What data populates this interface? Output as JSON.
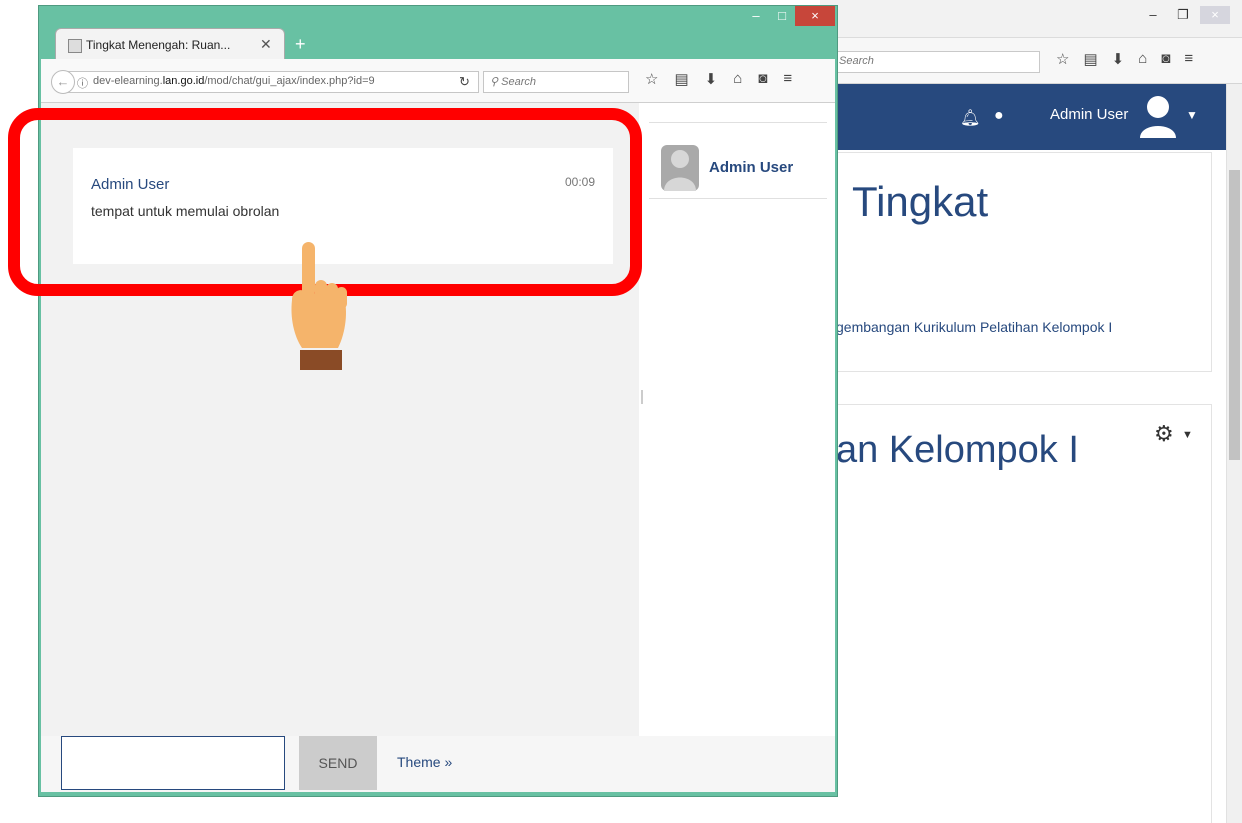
{
  "background_window": {
    "search_placeholder": "Search",
    "navbar": {
      "username": "Admin User"
    },
    "heading": "Tingkat",
    "breadcrumb": "gembangan Kurikulum Pelatihan Kelompok I",
    "section_heading": "an Kelompok I"
  },
  "popup": {
    "tab_title": "Tingkat Menengah: Ruan...",
    "url": {
      "prefix": "dev-elearning.",
      "domain": "lan.go.id",
      "path": "/mod/chat/gui_ajax/index.php?id=9"
    },
    "search_placeholder": "Search",
    "messages": [
      {
        "author": "Admin User",
        "time": "00:09",
        "text": "tempat untuk memulai obrolan"
      }
    ],
    "users": [
      {
        "name": "Admin User"
      }
    ],
    "send_label": "SEND",
    "theme_label": "Theme »"
  },
  "colors": {
    "window_frame": "#68c1a3",
    "brand_blue": "#27497e",
    "highlight": "#ff0000",
    "close_button": "#c7463a"
  },
  "icons": [
    "back-icon",
    "info-icon",
    "reload-icon",
    "search-icon",
    "star-icon",
    "reader-icon",
    "download-icon",
    "home-icon",
    "pocket-icon",
    "menu-icon",
    "bell-icon",
    "chat-bubble-icon",
    "user-avatar-icon",
    "gear-icon",
    "pointing-hand-icon"
  ]
}
